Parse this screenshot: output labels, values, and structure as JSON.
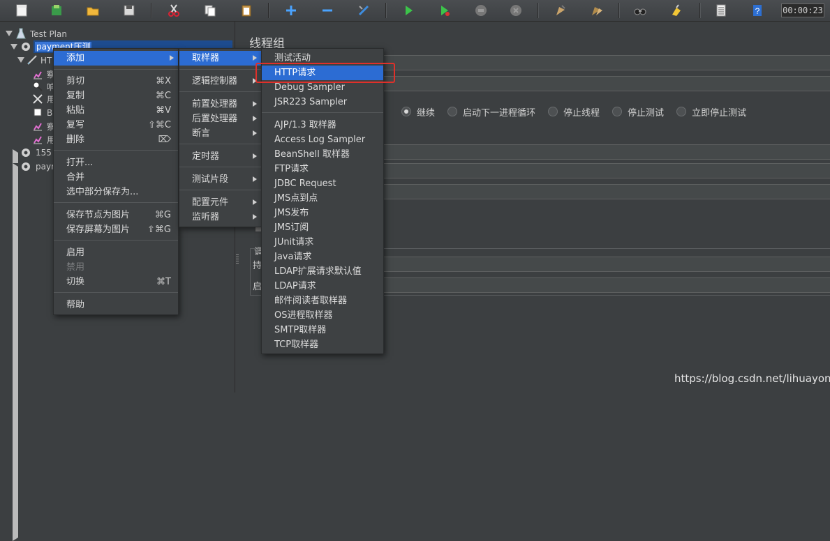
{
  "toolbar": {
    "buttons": [
      "new-icon",
      "templates-icon",
      "open-icon",
      "save-icon",
      "cut-icon",
      "copy-icon",
      "paste-icon",
      "expand-icon",
      "collapse-icon",
      "toggle-icon",
      "start-icon",
      "start-no-pause-icon",
      "stop-icon",
      "shutdown-icon",
      "clear-icon",
      "clear-all-icon",
      "search-icon",
      "reset-search-icon",
      "function-helper-icon",
      "help-icon"
    ],
    "timer": "00:00:23"
  },
  "tree": {
    "items": [
      {
        "label": "Test Plan"
      },
      {
        "label": "payment压测"
      },
      {
        "label": "HT"
      },
      {
        "label": "察"
      },
      {
        "label": "响"
      },
      {
        "label": "用"
      },
      {
        "label": "Be"
      },
      {
        "label": "察"
      },
      {
        "label": "用"
      },
      {
        "label": "155"
      },
      {
        "label": "payr"
      }
    ]
  },
  "panel": {
    "title": "线程组",
    "on_error_options": [
      "继续",
      "启动下一进程循环",
      "停止线程",
      "停止测试",
      "立即停止测试"
    ],
    "labels": [
      "调",
      "持",
      "启"
    ]
  },
  "context_menu": {
    "items": [
      {
        "label": "添加",
        "shortcut": ""
      },
      {
        "label": "剪切",
        "shortcut": "⌘X"
      },
      {
        "label": "复制",
        "shortcut": "⌘C"
      },
      {
        "label": "粘贴",
        "shortcut": "⌘V"
      },
      {
        "label": "复写",
        "shortcut": "⇧⌘C"
      },
      {
        "label": "删除",
        "shortcut": "⌦"
      },
      {
        "label": "打开...",
        "shortcut": ""
      },
      {
        "label": "合并",
        "shortcut": ""
      },
      {
        "label": "选中部分保存为...",
        "shortcut": ""
      },
      {
        "label": "保存节点为图片",
        "shortcut": "⌘G"
      },
      {
        "label": "保存屏幕为图片",
        "shortcut": "⇧⌘G"
      },
      {
        "label": "启用",
        "shortcut": ""
      },
      {
        "label": "禁用",
        "shortcut": ""
      },
      {
        "label": "切换",
        "shortcut": "⌘T"
      },
      {
        "label": "帮助",
        "shortcut": ""
      }
    ]
  },
  "add_menu": {
    "items": [
      {
        "label": "取样器"
      },
      {
        "label": "逻辑控制器"
      },
      {
        "label": "前置处理器"
      },
      {
        "label": "后置处理器"
      },
      {
        "label": "断言"
      },
      {
        "label": "定时器"
      },
      {
        "label": "测试片段"
      },
      {
        "label": "配置元件"
      },
      {
        "label": "监听器"
      }
    ]
  },
  "sampler_menu": {
    "items": [
      {
        "label": "测试活动"
      },
      {
        "label": "HTTP请求"
      },
      {
        "label": "Debug Sampler"
      },
      {
        "label": "JSR223 Sampler"
      },
      {
        "label": "AJP/1.3 取样器"
      },
      {
        "label": "Access Log Sampler"
      },
      {
        "label": "BeanShell 取样器"
      },
      {
        "label": "FTP请求"
      },
      {
        "label": "JDBC Request"
      },
      {
        "label": "JMS点到点"
      },
      {
        "label": "JMS发布"
      },
      {
        "label": "JMS订阅"
      },
      {
        "label": "JUnit请求"
      },
      {
        "label": "Java请求"
      },
      {
        "label": "LDAP扩展请求默认值"
      },
      {
        "label": "LDAP请求"
      },
      {
        "label": "邮件阅读者取样器"
      },
      {
        "label": "OS进程取样器"
      },
      {
        "label": "SMTP取样器"
      },
      {
        "label": "TCP取样器"
      }
    ]
  },
  "watermark": "https://blog.csdn.net/lihuayong",
  "colors": {
    "selection": "#2c6cd3",
    "highlight_border": "#e0302a"
  }
}
